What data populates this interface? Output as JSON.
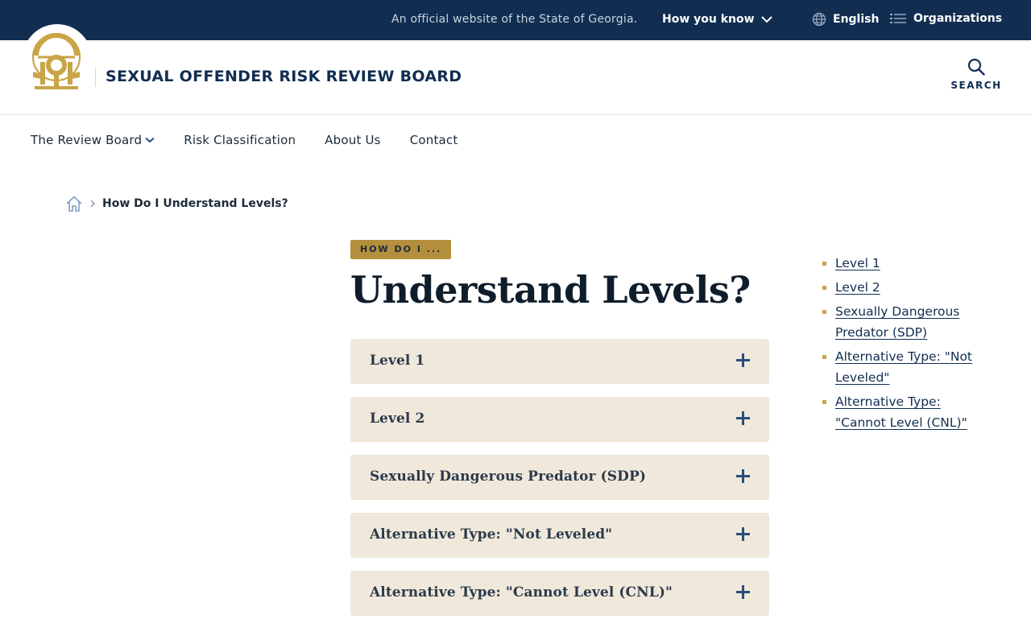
{
  "topbar": {
    "official_text": "An official website of the State of Georgia.",
    "how_you_know": "How you know",
    "language": "English",
    "organizations": "Organizations"
  },
  "header": {
    "site_title": "SEXUAL OFFENDER RISK REVIEW BOARD",
    "search_label": "SEARCH"
  },
  "nav": {
    "items": [
      {
        "label": "The Review Board",
        "has_dropdown": true
      },
      {
        "label": "Risk Classification"
      },
      {
        "label": "About Us"
      },
      {
        "label": "Contact"
      }
    ]
  },
  "breadcrumb": {
    "current": "How Do I Understand Levels?"
  },
  "main": {
    "kicker": "HOW DO I ...",
    "title": "Understand Levels?",
    "accordion": [
      {
        "label": "Level 1"
      },
      {
        "label": "Level 2"
      },
      {
        "label": "Sexually Dangerous Predator (SDP)"
      },
      {
        "label": "Alternative Type: \"Not Leveled\""
      },
      {
        "label": "Alternative Type: \"Cannot Level (CNL)\""
      }
    ]
  },
  "toc": {
    "items": [
      {
        "label": "Level 1"
      },
      {
        "label": "Level 2"
      },
      {
        "label": "Sexually Dangerous Predator (SDP)"
      },
      {
        "label": "Alternative Type: \"Not Leveled\""
      },
      {
        "label": "Alternative Type: \"Cannot Level (CNL)\""
      }
    ]
  },
  "colors": {
    "topbar_bg": "#112e51",
    "gold": "#b38e3d",
    "accordion_bg": "#f0e8db",
    "plus_icon": "#2a4d7c"
  }
}
